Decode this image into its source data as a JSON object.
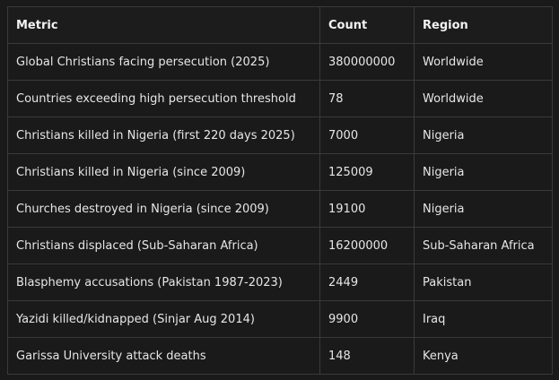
{
  "table": {
    "headers": [
      "Metric",
      "Count",
      "Region"
    ],
    "rows": [
      [
        "Global Christians facing persecution (2025)",
        "380000000",
        "Worldwide"
      ],
      [
        "Countries exceeding high persecution threshold",
        "78",
        "Worldwide"
      ],
      [
        "Christians killed in Nigeria (first 220 days 2025)",
        "7000",
        "Nigeria"
      ],
      [
        "Christians killed in Nigeria (since 2009)",
        "125009",
        "Nigeria"
      ],
      [
        "Churches destroyed in Nigeria (since 2009)",
        "19100",
        "Nigeria"
      ],
      [
        "Christians displaced (Sub-Saharan Africa)",
        "16200000",
        "Sub-Saharan Africa"
      ],
      [
        "Blasphemy accusations (Pakistan 1987-2023)",
        "2449",
        "Pakistan"
      ],
      [
        "Yazidi killed/kidnapped (Sinjar Aug 2014)",
        "9900",
        "Iraq"
      ],
      [
        "Garissa University attack deaths",
        "148",
        "Kenya"
      ]
    ]
  }
}
